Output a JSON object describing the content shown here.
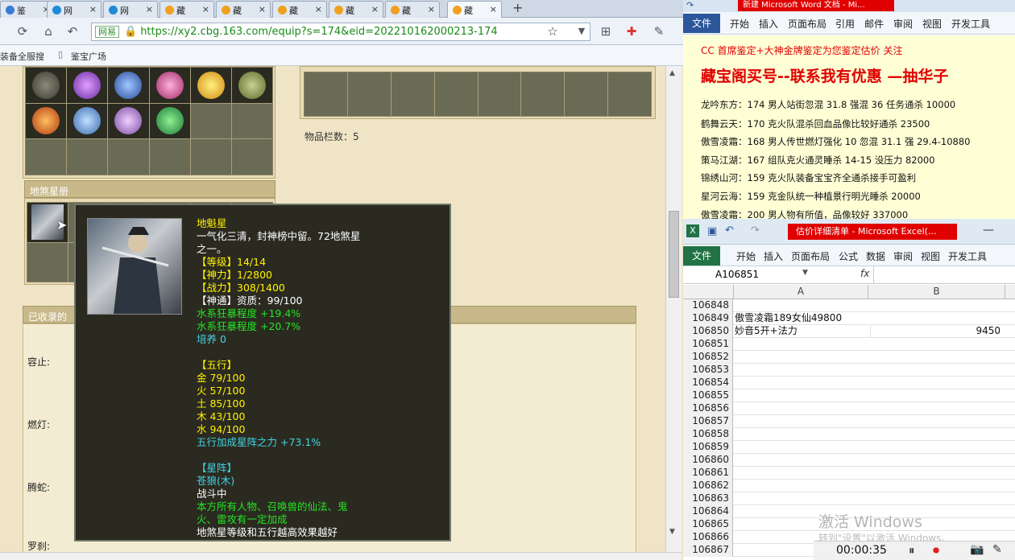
{
  "browser": {
    "tabs": [
      "鉴",
      "网",
      "网",
      "藏",
      "藏",
      "藏",
      "藏",
      "藏",
      "藏"
    ],
    "new_tab": "+",
    "url_badge": "网易",
    "url": "https://xy2.cbg.163.com/equip?s=174&eid=202210162000213-174",
    "bookmarks": [
      "装备全服搜",
      "鉴宝广场"
    ]
  },
  "page": {
    "section_star": "地煞星册",
    "item_count_label": "物品栏数：5",
    "section_collected": "已收录的",
    "side_labels": [
      "容止:",
      "燃灯:",
      "腾蛇:",
      "罗刹:"
    ]
  },
  "tooltip": {
    "name": "地魁星",
    "desc1": "一气化三清，封神榜中留。72地煞星",
    "desc2": "之一。",
    "level": "【等级】14/14",
    "shenli": "【神力】1/2800",
    "zhanli": "【战力】308/1400",
    "shentong": "【神通】资质：99/100",
    "attr1": "水系狂暴程度 +19.4%",
    "attr2": "水系狂暴程度 +20.7%",
    "peiyang": "培养 0",
    "wuxing_title": "【五行】",
    "jin": "金 79/100",
    "mu_huo": "火 57/100",
    "tu": "土 85/100",
    "mu": "木 43/100",
    "shui": "水 94/100",
    "wuxing_bonus": "五行加成星阵之力 +73.1%",
    "xingzhen_title": "【星阵】",
    "xingzhen_name": "苍狼(木)",
    "battle": "战斗中",
    "effect1": "本方所有人物、召唤兽的仙法、鬼",
    "effect2": "火、雷攻有一定加成",
    "note": "地煞星等级和五行越高效果越好"
  },
  "word": {
    "title": "新建 Microsoft Word 文档 - Mi...",
    "file_tab": "文件",
    "ribbon_tabs": [
      "开始",
      "插入",
      "页面布局",
      "引用",
      "邮件",
      "审阅",
      "视图",
      "开发工具"
    ],
    "headline1": "CC 首席鉴定+大神金牌鉴定为您鉴定估价 关注",
    "headline2": "藏宝阁买号--联系我有优惠 —抽华子",
    "lines": [
      "龙吟东方：174 男人站街忽混 31.8 强混 36 任务通杀 10000",
      "鹤舞云天：170 克火队混杀回血品像比较好通杀 23500",
      "傲雪凌霜：168 男人传世燃灯强化 10 忽混 31.1 强 29.4-10880",
      "策马江湖：167 组队克火通灵睡杀 14-15 没压力 82000",
      "锦绣山河：159 克火队装备宝宝齐全通杀接手可盈利",
      "星河云海：159 克金队统一种植景行明光睡杀 20000",
      "傲雪凌霜：200 男人物有所值，品像较好 337000"
    ]
  },
  "excel": {
    "title": "估价详细清单 - Microsoft Excel(...",
    "file_tab": "文件",
    "ribbon_tabs": [
      "开始",
      "插入",
      "页面布局",
      "公式",
      "数据",
      "审阅",
      "视图",
      "开发工具"
    ],
    "name_box": "A106851",
    "fx": "fx",
    "col_a": "A",
    "col_b": "B",
    "rows": [
      {
        "n": "106848",
        "a": "",
        "b": ""
      },
      {
        "n": "106849",
        "a": "傲雪凌霜189女仙49800",
        "b": ""
      },
      {
        "n": "106850",
        "a": "妙音5开+法力",
        "b": "9450"
      },
      {
        "n": "106851",
        "a": "",
        "b": ""
      },
      {
        "n": "106852",
        "a": "",
        "b": ""
      },
      {
        "n": "106853",
        "a": "",
        "b": ""
      },
      {
        "n": "106854",
        "a": "",
        "b": ""
      },
      {
        "n": "106855",
        "a": "",
        "b": ""
      },
      {
        "n": "106856",
        "a": "",
        "b": ""
      },
      {
        "n": "106857",
        "a": "",
        "b": ""
      },
      {
        "n": "106858",
        "a": "",
        "b": ""
      },
      {
        "n": "106859",
        "a": "",
        "b": ""
      },
      {
        "n": "106860",
        "a": "",
        "b": ""
      },
      {
        "n": "106861",
        "a": "",
        "b": ""
      },
      {
        "n": "106862",
        "a": "",
        "b": ""
      },
      {
        "n": "106863",
        "a": "",
        "b": ""
      },
      {
        "n": "106864",
        "a": "",
        "b": ""
      },
      {
        "n": "106865",
        "a": "",
        "b": ""
      },
      {
        "n": "106866",
        "a": "",
        "b": ""
      },
      {
        "n": "106867",
        "a": "",
        "b": ""
      }
    ]
  },
  "overlay": {
    "watermark1": "激活 Windows",
    "watermark2": "转到\"设置\"以激活 Windows。",
    "timer": "00:00:35"
  }
}
